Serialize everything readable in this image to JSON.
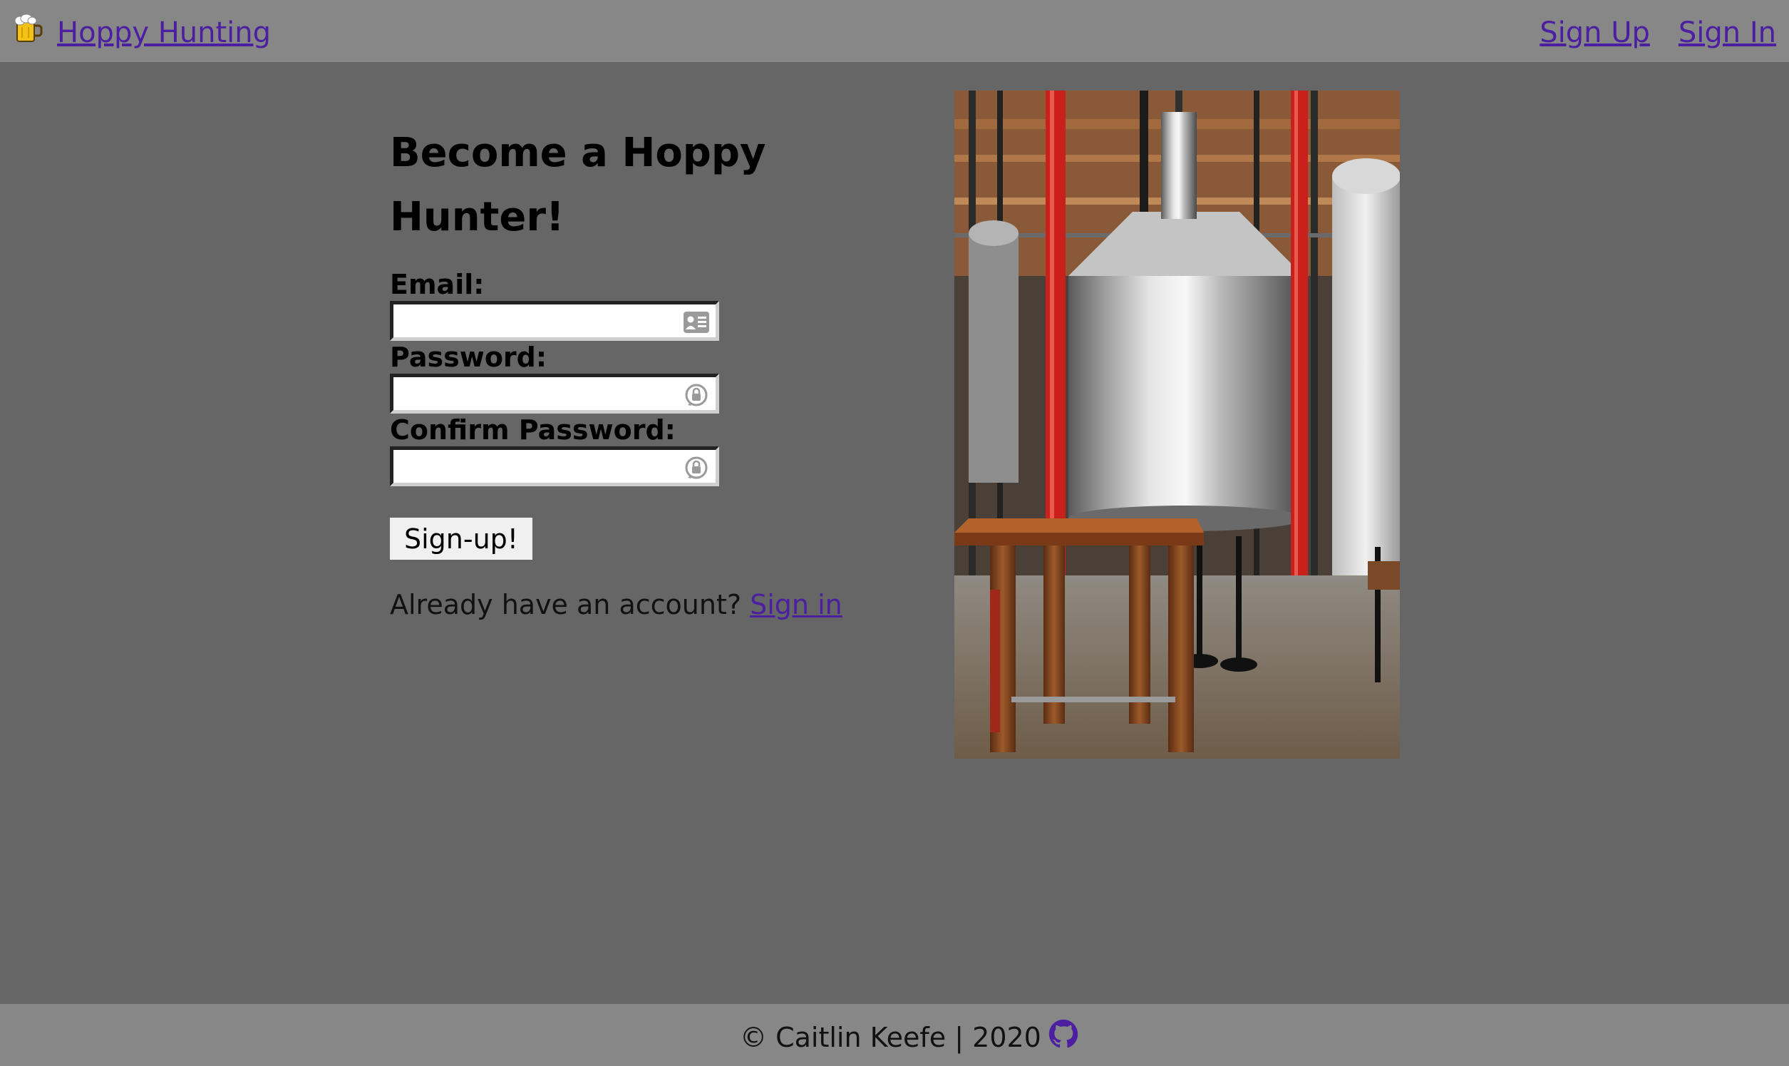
{
  "nav": {
    "brand": "Hoppy Hunting",
    "brand_icon": "beer-mug-icon",
    "links": [
      "Sign Up",
      "Sign In"
    ]
  },
  "form": {
    "heading": "Become a Hoppy Hunter!",
    "email_label": "Email:",
    "email_value": "",
    "password_label": "Password:",
    "password_value": "",
    "confirm_label": "Confirm Password:",
    "confirm_value": "",
    "submit_label": "Sign-up!",
    "account_prompt": "Already have an account?",
    "signin_link": "Sign in"
  },
  "image": {
    "subject": "brewery-interior"
  },
  "footer": {
    "text": "© Caitlin Keefe | 2020",
    "icon": "github-icon"
  },
  "colors": {
    "page_bg": "#666666",
    "bar_bg": "#878787",
    "link": "#4b1fa0",
    "tank_red": "#c9201c"
  }
}
